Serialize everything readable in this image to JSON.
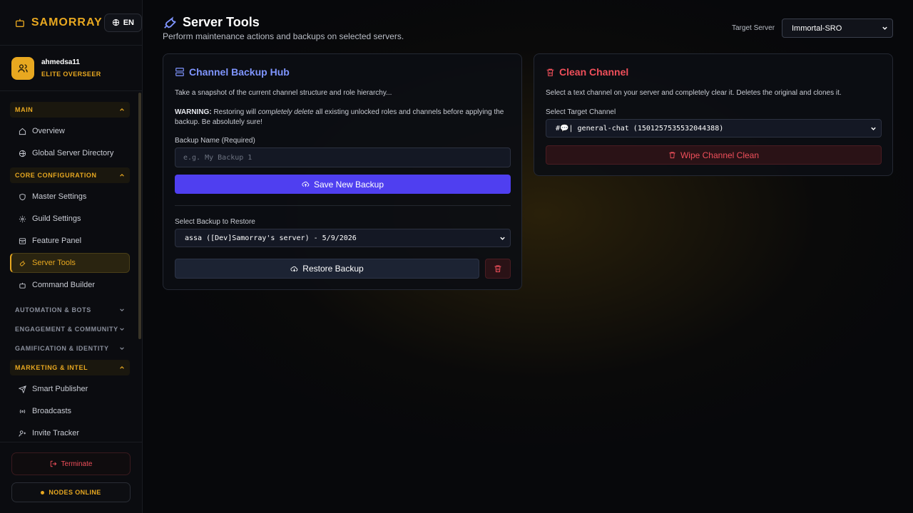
{
  "app": {
    "brand": "SAMORRAY",
    "language": "EN"
  },
  "user": {
    "name": "ahmedsa11",
    "role": "ELITE OVERSEER"
  },
  "sidebar": {
    "sections": [
      {
        "label": "MAIN",
        "open": true,
        "items": [
          "Overview",
          "Global Server Directory"
        ]
      },
      {
        "label": "CORE CONFIGURATION",
        "open": true,
        "items": [
          "Master Settings",
          "Guild Settings",
          "Feature Panel",
          "Server Tools",
          "Command Builder"
        ]
      },
      {
        "label": "AUTOMATION & BOTS",
        "open": false,
        "items": []
      },
      {
        "label": "ENGAGEMENT & COMMUNITY",
        "open": false,
        "items": []
      },
      {
        "label": "GAMIFICATION & IDENTITY",
        "open": false,
        "items": []
      },
      {
        "label": "MARKETING & INTEL",
        "open": true,
        "items": [
          "Smart Publisher",
          "Broadcasts",
          "Invite Tracker"
        ]
      }
    ],
    "active_item": "Server Tools",
    "terminate_label": "Terminate",
    "nodes_label": "NODES ONLINE"
  },
  "header": {
    "title": "Server Tools",
    "subtitle": "Perform maintenance actions and backups on selected servers.",
    "target_label": "Target Server",
    "target_value": "Immortal-SRO"
  },
  "backup": {
    "title": "Channel Backup Hub",
    "description": "Take a snapshot of the current channel structure and role hierarchy...",
    "warning_prefix": "WARNING:",
    "warning_a": " Restoring will ",
    "warning_em": "completely delete",
    "warning_b": " all existing unlocked roles and channels before applying the backup. Be absolutely sure!",
    "name_label": "Backup Name (Required)",
    "name_placeholder": "e.g. My Backup 1",
    "save_label": "Save New Backup",
    "restore_select_label": "Select Backup to Restore",
    "restore_selected": "assa ([Dev]Samorray's server) - 5/9/2026",
    "restore_label": "Restore Backup"
  },
  "clean": {
    "title": "Clean Channel",
    "description": "Select a text channel on your server and completely clear it. Deletes the original and clones it.",
    "target_label": "Select Target Channel",
    "channel_prefix": "#💬|",
    "channel_value": "general-chat (1501257535532044388)",
    "wipe_label": "Wipe Channel Clean"
  },
  "colors": {
    "accent": "#e8a820",
    "primary": "#4f3ff0",
    "danger": "#ef4f5a",
    "title_blue": "#7f95ff"
  }
}
